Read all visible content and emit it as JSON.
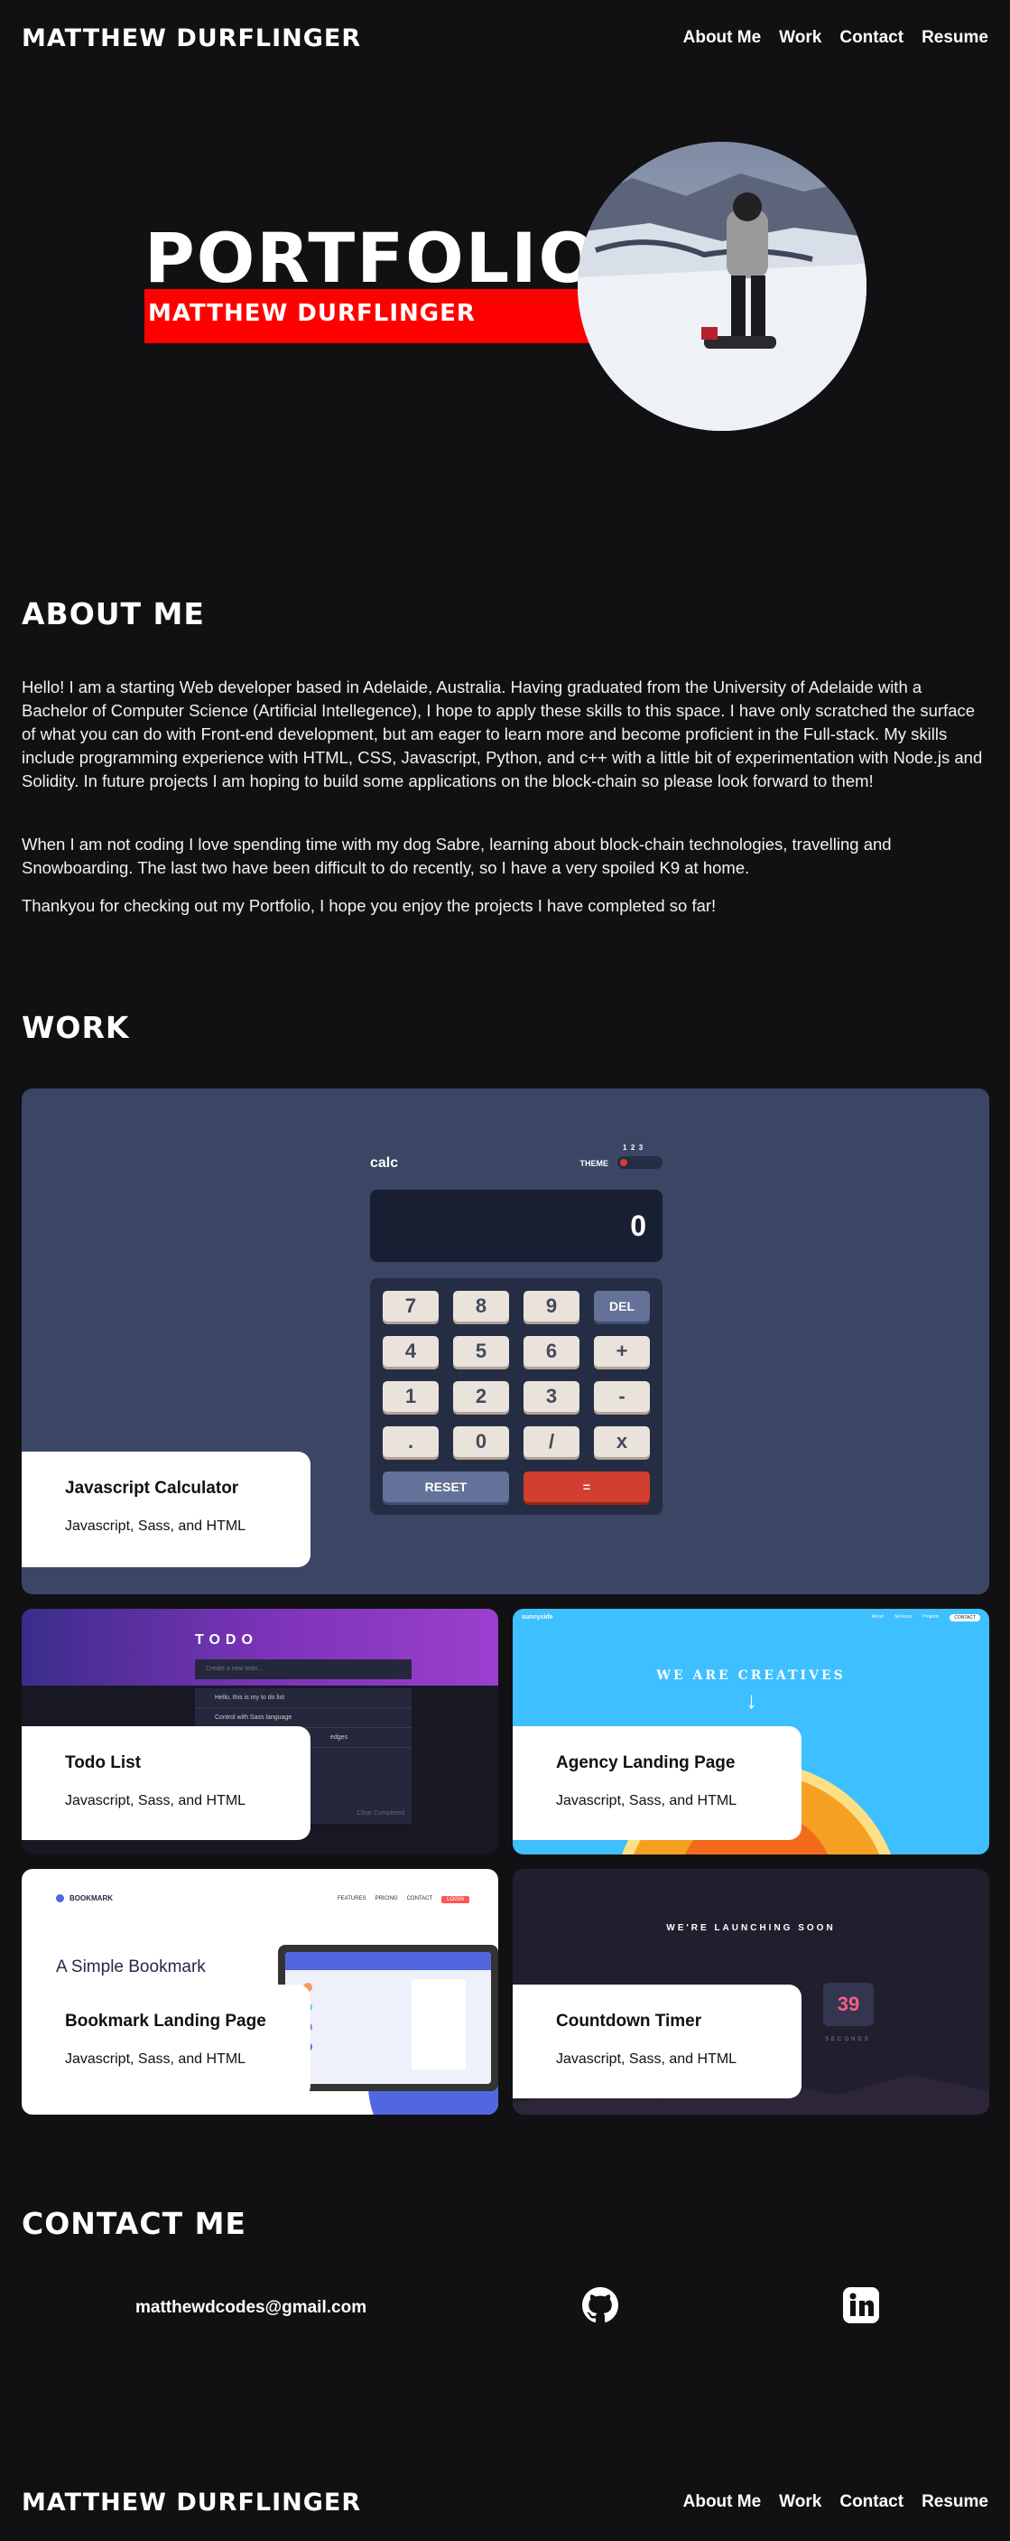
{
  "header": {
    "brand": "MATTHEW DURFLINGER",
    "nav": [
      "About Me",
      "Work",
      "Contact",
      "Resume"
    ]
  },
  "hero": {
    "title": "PORTFOLIO",
    "subtitle": "MATTHEW DURFLINGER"
  },
  "about": {
    "title": "ABOUT ME",
    "paragraphs": [
      "Hello! I am a starting Web developer based in Adelaide, Australia. Having graduated from the University of Adelaide with a Bachelor of Computer Science (Artificial Intellegence), I hope to apply these skills to this space. I have only scratched the surface of what you can do with Front-end development, but am eager to learn more and become proficient in the Full-stack. My skills include programming experience with HTML, CSS, Javascript, Python, and c++ with a little bit of experimentation with Node.js and Solidity. In future projects I am hoping to build some applications on the block-chain so please look forward to them!",
      "When I am not coding I love spending time with my dog Sabre, learning about block-chain technologies, travelling and Snowboarding. The last two have been difficult to do recently, so I have a very spoiled K9 at home.",
      "Thankyou for checking out my Portfolio, I hope you enjoy the projects I have completed so far!"
    ]
  },
  "work": {
    "title": "WORK",
    "projects": [
      {
        "title": "Javascript Calculator",
        "stack": "Javascript, Sass, and HTML"
      },
      {
        "title": "Todo List",
        "stack": "Javascript, Sass, and HTML"
      },
      {
        "title": "Agency Landing Page",
        "stack": "Javascript, Sass, and HTML"
      },
      {
        "title": "Bookmark Landing Page",
        "stack": "Javascript, Sass, and HTML"
      },
      {
        "title": "Countdown Timer",
        "stack": "Javascript, Sass, and HTML"
      }
    ],
    "calc_preview": {
      "logo": "calc",
      "theme_label": "THEME",
      "theme_nums": "1  2  3",
      "display": "0",
      "keys": [
        "7",
        "8",
        "9",
        "DEL",
        "4",
        "5",
        "6",
        "+",
        "1",
        "2",
        "3",
        "-",
        ".",
        "0",
        "/",
        "x"
      ],
      "reset": "RESET",
      "equals": "="
    },
    "todo_preview": {
      "title": "TODO",
      "input": "Create a new todo...",
      "items": [
        "Hello, this is my to do list",
        "Control with Sass language",
        "",
        "",
        "edges"
      ],
      "filter": "Clear Completed"
    },
    "agency_preview": {
      "logo": "sunnyside",
      "headline": "WE ARE CREATIVES",
      "nav": [
        "About",
        "Services",
        "Projects",
        "CONTACT"
      ]
    },
    "bookmark_preview": {
      "logo": "BOOKMARK",
      "nav": [
        "FEATURES",
        "PRICING",
        "CONTACT",
        "LOGIN"
      ],
      "headline": "A Simple Bookmark Manager"
    },
    "countdown_preview": {
      "headline": "WE'RE LAUNCHING SOON",
      "value": "39",
      "unit": "SECONDS"
    }
  },
  "contact": {
    "title": "CONTACT ME",
    "email": "matthewdcodes@gmail.com",
    "icons": [
      "github-icon",
      "linkedin-icon"
    ]
  },
  "footer": {
    "brand": "MATTHEW DURFLINGER",
    "nav": [
      "About Me",
      "Work",
      "Contact",
      "Resume"
    ]
  }
}
